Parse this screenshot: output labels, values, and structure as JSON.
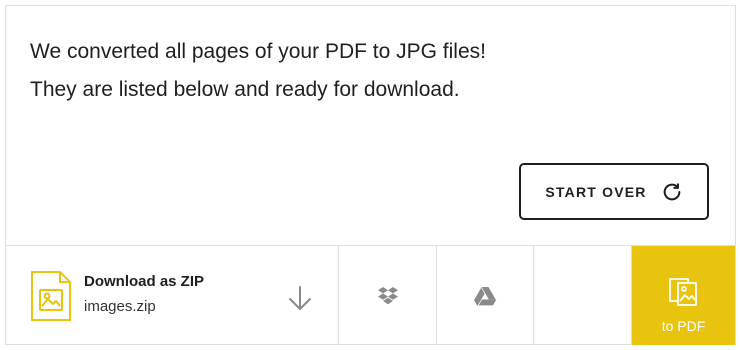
{
  "message": "We converted all pages of your PDF to JPG files! They are listed below and ready for download.",
  "start_over": {
    "label": "START OVER",
    "icon": "refresh-icon"
  },
  "download": {
    "title": "Download as ZIP",
    "filename": "images.zip",
    "file_icon": "image-file-icon",
    "action_icon": "download-arrow-icon"
  },
  "integrations": [
    {
      "name": "Dropbox",
      "icon": "dropbox-icon"
    },
    {
      "name": "Google Drive",
      "icon": "google-drive-icon"
    }
  ],
  "to_pdf": {
    "label": "to PDF",
    "icon": "images-to-pdf-icon"
  },
  "colors": {
    "accent": "#e8c40e",
    "text": "#1f1f1f",
    "border": "#dedede",
    "icon_gray": "#8a8a8a"
  }
}
